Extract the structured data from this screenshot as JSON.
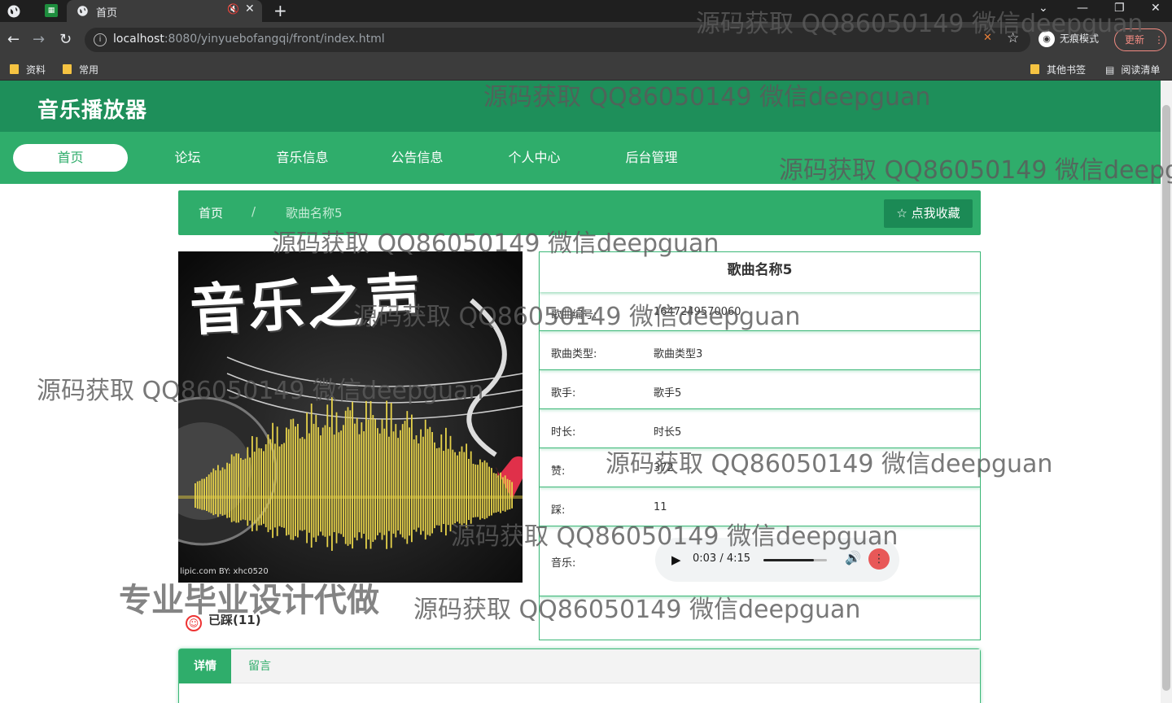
{
  "browser": {
    "tab_title": "首页",
    "url_host": "localhost",
    "url_rest": ":8080/yinyuebofangqi/front/index.html",
    "incognito_label": "无痕模式",
    "update_label": "更新",
    "bookmarks": [
      "资料",
      "常用"
    ],
    "bookmarks_right": [
      "其他书签",
      "阅读清单"
    ]
  },
  "site": {
    "title": "音乐播放器",
    "nav": [
      "首页",
      "论坛",
      "音乐信息",
      "公告信息",
      "个人中心",
      "后台管理"
    ],
    "active_nav": 0
  },
  "breadcrumb": {
    "home": "首页",
    "separator": "/",
    "current": "歌曲名称5"
  },
  "favorite_button": "☆ 点我收藏",
  "album": {
    "title_text": "音乐之声",
    "credit": "lipic.com    BY: xhc0520"
  },
  "tread_status": "已踩(11)",
  "song": {
    "name": "歌曲名称5",
    "rows": [
      {
        "label": "歌曲编号:",
        "value": "1647249570060"
      },
      {
        "label": "歌曲类型:",
        "value": "歌曲类型3"
      },
      {
        "label": "歌手:",
        "value": "歌手5"
      },
      {
        "label": "时长:",
        "value": "时长5"
      },
      {
        "label": "赞:",
        "value": "372"
      },
      {
        "label": "踩:",
        "value": "11"
      }
    ],
    "music_label": "音乐:"
  },
  "player": {
    "time": "0:03 / 4:15",
    "volume_fraction": 0.8
  },
  "tabs": [
    "详情",
    "留言"
  ],
  "watermark": "源码获取 QQ86050149 微信deepguan",
  "watermark_big": "专业毕业设计代做",
  "colors": {
    "header": "#1e8f5a",
    "nav": "#2fad6b",
    "accent": "#3cb878"
  }
}
